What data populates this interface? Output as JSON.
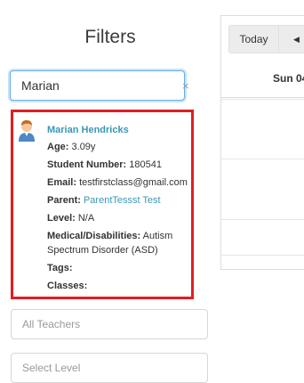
{
  "filters": {
    "title": "Filters",
    "search": {
      "value": "Marian",
      "clear_glyph": "×"
    }
  },
  "student_card": {
    "avatar_icon": "student-avatar-icon",
    "highlight_color": "#e11d22",
    "link_color": "#3a97b4",
    "name": "Marian Hendricks",
    "age_label": "Age:",
    "age_value": "3.09y",
    "student_number_label": "Student Number:",
    "student_number_value": "180541",
    "email_label": "Email:",
    "email_value": "testfirstclass@gmail.com",
    "parent_label": "Parent:",
    "parent_value": "ParentTessst Test",
    "level_label": "Level:",
    "level_value": "N/A",
    "medical_label": "Medical/Disabilities:",
    "medical_value": "Autism Spectrum Disorder (ASD)",
    "tags_label": "Tags:",
    "classes_label": "Classes:"
  },
  "teachers_select": {
    "placeholder": "All Teachers"
  },
  "level_select": {
    "placeholder": "Select Level"
  },
  "calendar": {
    "today_label": "Today",
    "prev_icon": "triangle-left-icon",
    "prev_glyph": "◀",
    "day_header": "Sun 04"
  }
}
